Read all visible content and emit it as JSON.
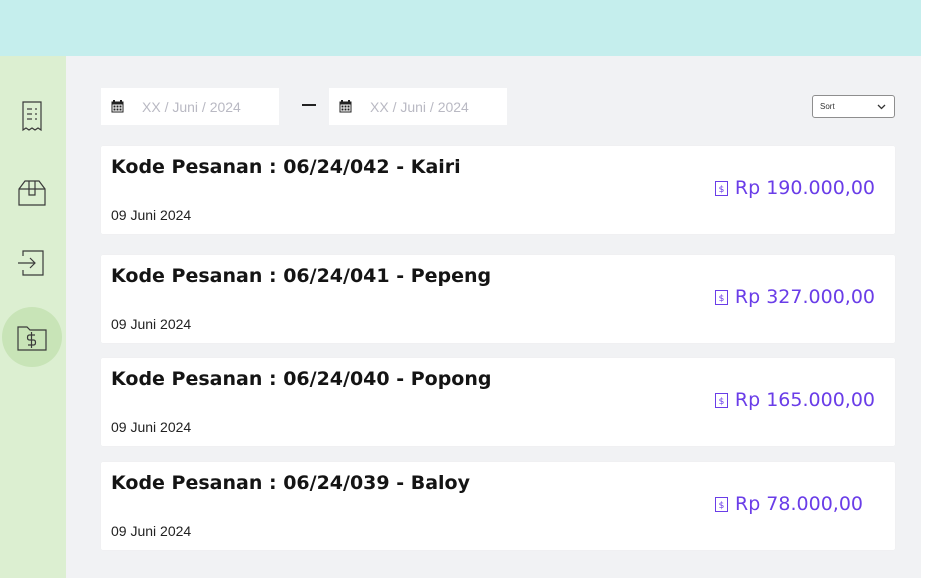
{
  "filters": {
    "start_date_placeholder": "XX / Juni / 2024",
    "end_date_placeholder": "XX / Juni / 2024",
    "sort_label": "Sort"
  },
  "sidebar": {
    "items": [
      {
        "icon": "receipt-icon"
      },
      {
        "icon": "package-icon"
      },
      {
        "icon": "login-icon"
      },
      {
        "icon": "money-folder-icon",
        "active": true
      }
    ]
  },
  "orders": [
    {
      "title": "Kode Pesanan : 06/24/042 - Kairi",
      "date": "09 Juni 2024",
      "price": "Rp 190.000,00"
    },
    {
      "title": "Kode Pesanan : 06/24/041 - Pepeng",
      "date": "09 Juni 2024",
      "price": "Rp 327.000,00"
    },
    {
      "title": "Kode Pesanan : 06/24/040 - Popong",
      "date": "09 Juni 2024",
      "price": "Rp 165.000,00"
    },
    {
      "title": "Kode Pesanan : 06/24/039 - Baloy",
      "date": "09 Juni 2024",
      "price": "Rp 78.000,00"
    }
  ],
  "colors": {
    "topbar": "#c5eeed",
    "sidebar": "#dcefd1",
    "sidebar_active": "#c8e4b7",
    "price": "#6a3de8",
    "background": "#f1f2f4"
  }
}
